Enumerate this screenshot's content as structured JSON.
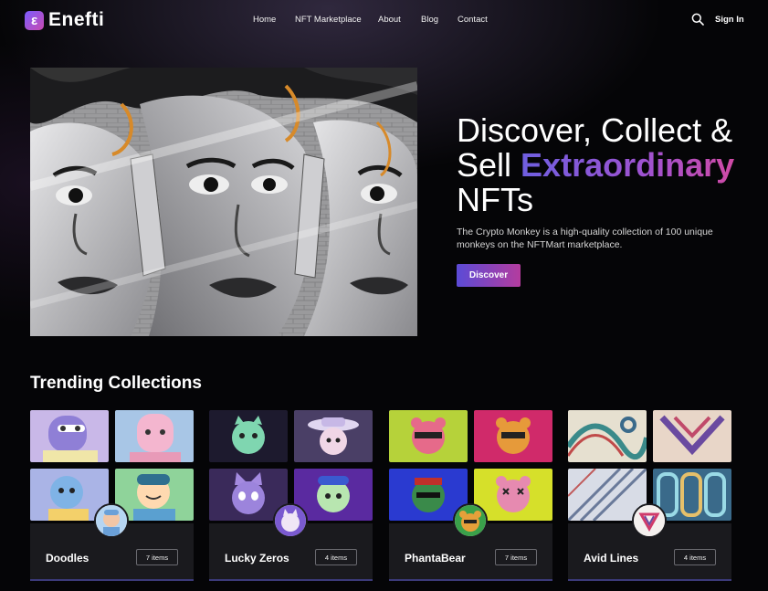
{
  "brand": {
    "logo_letter": "ε",
    "name": "Enefti",
    "accent_start": "#6f5fe0",
    "accent_end": "#d04aa5"
  },
  "nav": {
    "items": [
      {
        "label": "Home"
      },
      {
        "label": "NFT Marketplace"
      },
      {
        "label": "About"
      },
      {
        "label": "Blog"
      },
      {
        "label": "Contact"
      }
    ],
    "search_icon": "search-icon",
    "signin_label": "Sign In"
  },
  "hero": {
    "title_part1": "Discover, Collect &",
    "title_part2": "Sell",
    "title_highlight": "Extraordinary",
    "title_part3": "NFTs",
    "description": "The Crypto Monkey is a high-quality collection of 100 unique monkeys on the NFTMart marketplace.",
    "cta_label": "Discover"
  },
  "trending": {
    "title": "Trending Collections",
    "collections": [
      {
        "name": "Doodles",
        "count": "7 items"
      },
      {
        "name": "Lucky Zeros",
        "count": "4 items"
      },
      {
        "name": "PhantaBear",
        "count": "7 items"
      },
      {
        "name": "Avid Lines",
        "count": "4 items"
      }
    ]
  }
}
